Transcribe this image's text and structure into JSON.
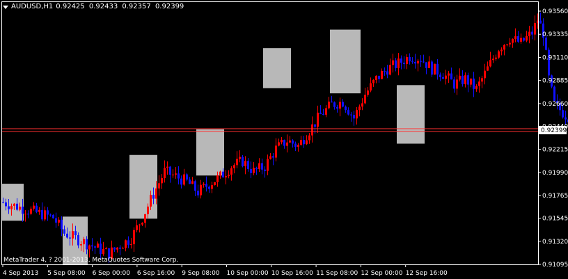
{
  "header": {
    "symbol": "AUDUSD,H1",
    "ohlc": [
      "0.92425",
      "0.92433",
      "0.92357",
      "0.92399"
    ]
  },
  "copyright": "MetaTrader 4, ? 2001-2013, MetaQuotes Software Corp.",
  "colors": {
    "background": "#000000",
    "bull": "#ff0000",
    "bear": "#1010ff",
    "highlight": "#b8b8b8",
    "price_line": "#ff3030",
    "axis": "#ffffff"
  },
  "chart_data": {
    "type": "candlestick",
    "current_price": "0.92399",
    "y_ticks": [
      "0.93560",
      "0.93335",
      "0.93110",
      "0.92885",
      "0.92660",
      "0.92440",
      "0.92215",
      "0.91990",
      "0.91765",
      "0.91545",
      "0.91320",
      "0.91095"
    ],
    "ylim": [
      0.91095,
      0.9356
    ],
    "x_ticks": [
      "4 Sep 2013",
      "5 Sep 08:00",
      "6 Sep 00:00",
      "6 Sep 16:00",
      "9 Sep 08:00",
      "10 Sep 00:00",
      "10 Sep 16:00",
      "11 Sep 08:00",
      "12 Sep 00:00",
      "12 Sep 16:00"
    ],
    "anchors": [
      [
        0,
        0.917
      ],
      [
        6,
        0.9165
      ],
      [
        12,
        0.916
      ],
      [
        18,
        0.9155
      ],
      [
        22,
        0.914
      ],
      [
        26,
        0.9135
      ],
      [
        30,
        0.913
      ],
      [
        34,
        0.9125
      ],
      [
        38,
        0.912
      ],
      [
        42,
        0.9128
      ],
      [
        46,
        0.9135
      ],
      [
        50,
        0.9155
      ],
      [
        54,
        0.9178
      ],
      [
        58,
        0.92
      ],
      [
        62,
        0.9195
      ],
      [
        66,
        0.919
      ],
      [
        70,
        0.918
      ],
      [
        74,
        0.9188
      ],
      [
        78,
        0.9195
      ],
      [
        82,
        0.9205
      ],
      [
        86,
        0.921
      ],
      [
        90,
        0.92
      ],
      [
        94,
        0.9205
      ],
      [
        98,
        0.9222
      ],
      [
        102,
        0.923
      ],
      [
        106,
        0.9225
      ],
      [
        110,
        0.924
      ],
      [
        114,
        0.9255
      ],
      [
        118,
        0.9265
      ],
      [
        122,
        0.9268
      ],
      [
        126,
        0.9252
      ],
      [
        130,
        0.9275
      ],
      [
        134,
        0.929
      ],
      [
        138,
        0.93
      ],
      [
        142,
        0.9305
      ],
      [
        146,
        0.9312
      ],
      [
        150,
        0.931
      ],
      [
        154,
        0.93
      ],
      [
        158,
        0.9295
      ],
      [
        162,
        0.9285
      ],
      [
        166,
        0.929
      ],
      [
        170,
        0.928
      ],
      [
        174,
        0.93
      ],
      [
        178,
        0.932
      ],
      [
        182,
        0.933
      ],
      [
        186,
        0.9325
      ],
      [
        190,
        0.9335
      ],
      [
        192,
        0.9348
      ],
      [
        194,
        0.9335
      ],
      [
        196,
        0.929
      ],
      [
        198,
        0.9265
      ],
      [
        202,
        0.9255
      ],
      [
        206,
        0.925
      ],
      [
        210,
        0.9238
      ],
      [
        214,
        0.9245
      ],
      [
        218,
        0.9265
      ],
      [
        222,
        0.9275
      ],
      [
        226,
        0.9268
      ],
      [
        230,
        0.9272
      ],
      [
        234,
        0.9262
      ],
      [
        238,
        0.9258
      ],
      [
        240,
        0.924
      ]
    ],
    "highlight_boxes": [
      {
        "from": 0,
        "to": 7,
        "low": 0.9152,
        "high": 0.9188
      },
      {
        "from": 22,
        "to": 30,
        "low": 0.91095,
        "high": 0.9156
      },
      {
        "from": 46,
        "to": 55,
        "low": 0.9154,
        "high": 0.9216
      },
      {
        "from": 70,
        "to": 79,
        "low": 0.9196,
        "high": 0.9241
      },
      {
        "from": 94,
        "to": 103,
        "low": 0.9281,
        "high": 0.932
      },
      {
        "from": 118,
        "to": 128,
        "low": 0.9276,
        "high": 0.9338
      },
      {
        "from": 142,
        "to": 151,
        "low": 0.9227,
        "high": 0.9284
      }
    ]
  }
}
